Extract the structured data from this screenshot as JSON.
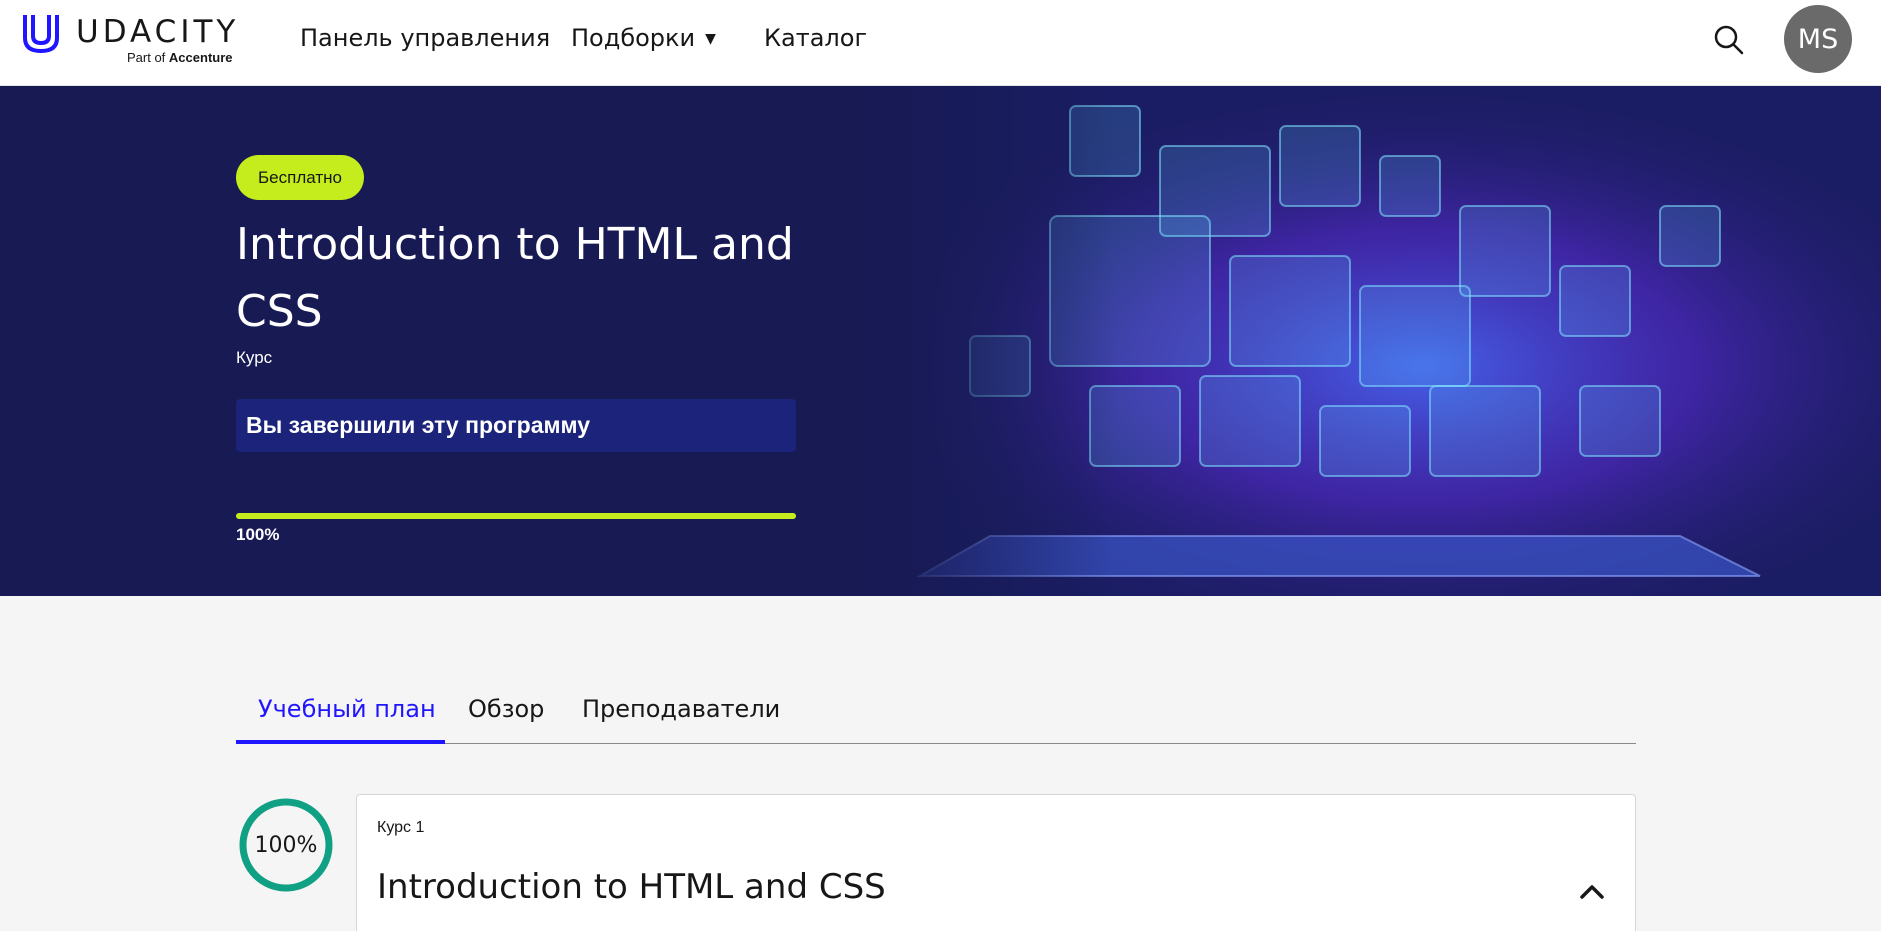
{
  "brand": {
    "name": "UDACITY",
    "tagline_prefix": "Part of",
    "tagline_company": "Accenture",
    "color": "#2015ff"
  },
  "nav": {
    "items": [
      {
        "label": "Панель управления"
      },
      {
        "label": "Подборки",
        "icon": "caret-down-icon"
      },
      {
        "label": "Каталог"
      }
    ],
    "search_icon": "search-icon",
    "avatar_initials": "MS"
  },
  "hero": {
    "badge": "Бесплатно",
    "title": "Introduction to HTML and CSS",
    "type": "Курс",
    "completed_message": "Вы завершили эту программу",
    "progress_percent": 100,
    "progress_label": "100%",
    "accent_color": "#c5ec1c",
    "background_color": "#171a53"
  },
  "tabs": [
    {
      "label": "Учебный план",
      "active": true
    },
    {
      "label": "Обзор",
      "active": false
    },
    {
      "label": "Преподаватели",
      "active": false
    }
  ],
  "course": {
    "progress_label": "100%",
    "progress_fraction": 1.0,
    "ring_color": "#10a084",
    "label": "Курс 1",
    "title": "Introduction to HTML and CSS",
    "toggle_icon": "chevron-up-icon"
  }
}
